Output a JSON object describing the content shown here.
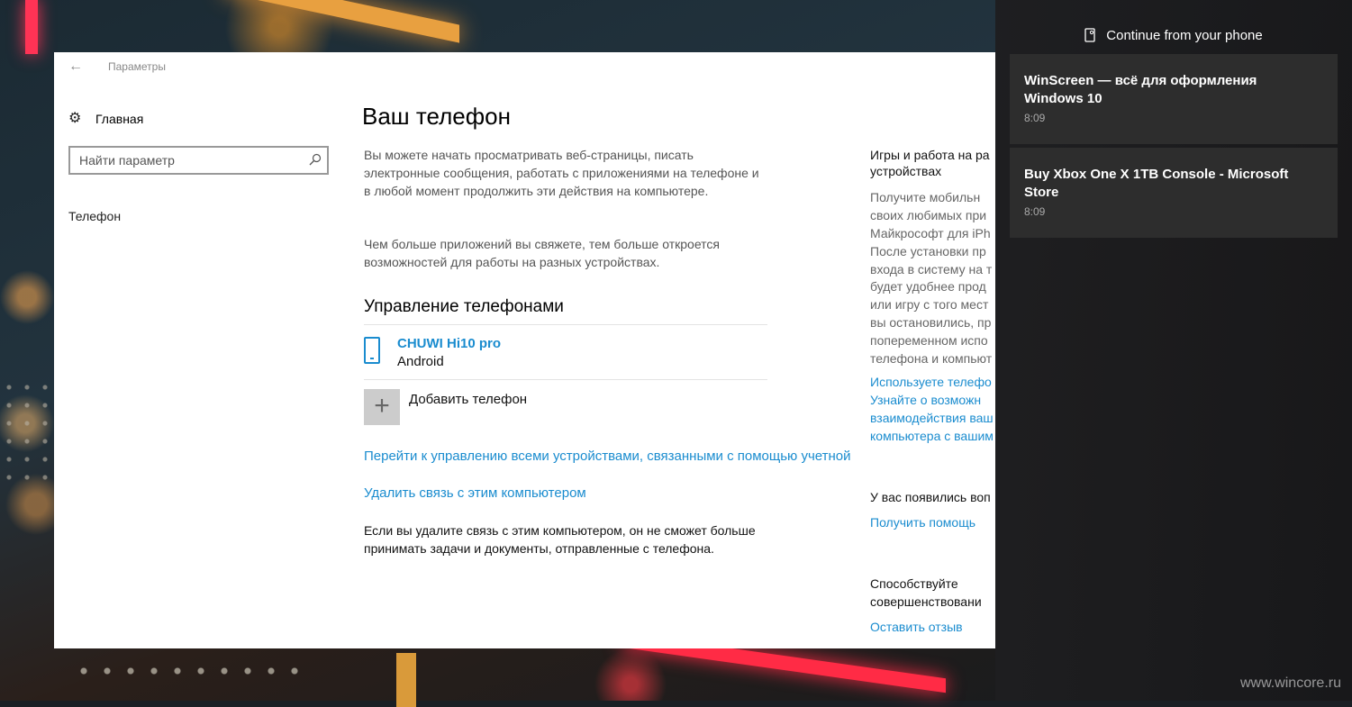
{
  "window": {
    "title": "Параметры"
  },
  "sidebar": {
    "home_label": "Главная",
    "search_placeholder": "Найти параметр",
    "items": [
      {
        "label": "Телефон"
      }
    ]
  },
  "main": {
    "title": "Ваш телефон",
    "intro_1": "Вы можете начать просматривать веб-страницы, писать электронные сообщения, работать с приложениями на телефоне и в любой момент продолжить эти действия на компьютере.",
    "intro_2": "Чем больше приложений вы свяжете, тем больше откроется возможностей для работы на разных устройствах.",
    "section_title": "Управление телефонами",
    "device": {
      "name": "CHUWI Hi10 pro",
      "os": "Android"
    },
    "add_phone_label": "Добавить телефон",
    "manage_link": "Перейти к управлению всеми устройствами, связанными с помощью учетной",
    "unlink_link": "Удалить связь с этим компьютером",
    "unlink_note": "Если вы удалите связь с этим компьютером, он не сможет больше принимать задачи и документы, отправленные с телефона."
  },
  "side": {
    "heading_1a": "Игры и работа на ра",
    "heading_1b": "устройствах",
    "body_lines": [
      "Получите мобильн",
      "своих любимых при",
      "Майкрософт для iPh",
      "После установки пр",
      "входа в систему на т",
      "будет удобнее прод",
      "или игру с того мест",
      "вы остановились, пр",
      "попеременном испо",
      "телефона и компьют"
    ],
    "link_lines": [
      "Используете телефо",
      "Узнайте о возможн",
      "взаимодействия ваш",
      "компьютера с вашим"
    ],
    "help_heading": "У вас появились воп",
    "help_link": "Получить помощь",
    "feedback_heading_a": "Способствуйте",
    "feedback_heading_b": "совершенствовани",
    "feedback_link": "Оставить отзыв"
  },
  "panel": {
    "header": "Continue from your phone",
    "cards": [
      {
        "title": "WinScreen — всё для оформления Windows 10",
        "time": "8:09"
      },
      {
        "title": "Buy Xbox One X 1TB Console - Microsoft Store",
        "time": "8:09"
      }
    ]
  },
  "watermark": "www.wincore.ru",
  "colors": {
    "accent": "#1a8ccf",
    "panel_bg": "#1e1e20",
    "card_bg": "#2d2d2d"
  }
}
